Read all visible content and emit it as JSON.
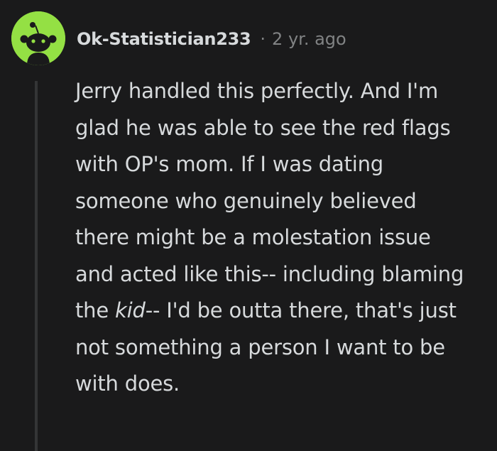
{
  "comment": {
    "author": "Ok-Statistician233",
    "separator": "·",
    "timestamp": "2 yr. ago",
    "avatar_icon": "reddit-snoo-avatar",
    "avatar_color": "#94e044",
    "body_before_emphasis": "Jerry handled this perfectly. And I'm glad he was able to see the red flags with OP's mom. If I was dating someone who genuinely believed there might be a molestation issue and acted like this-- including blaming the ",
    "body_emphasis": "kid",
    "body_after_emphasis": "-- I'd be outta there, that's just not something a person I want to be with does."
  }
}
